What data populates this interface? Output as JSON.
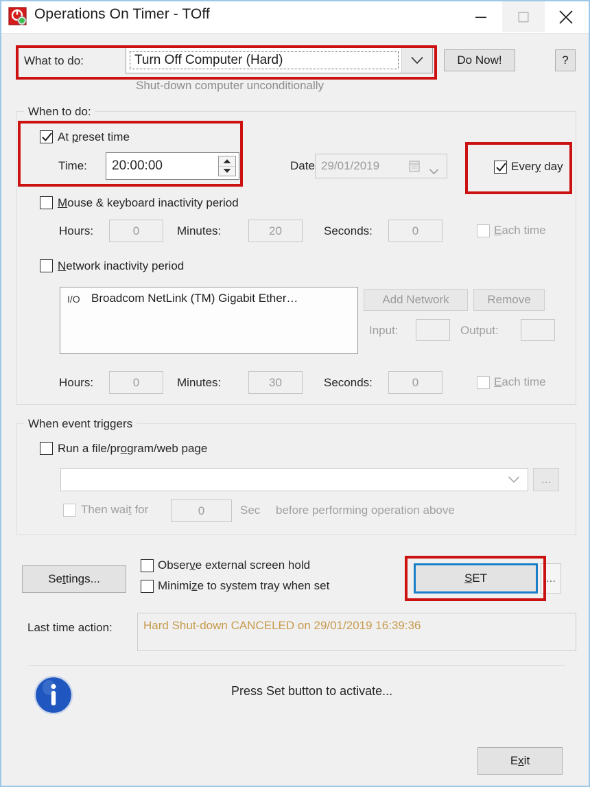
{
  "window": {
    "title": "Operations On Timer - TOff",
    "icon": "toff-app-icon",
    "controls": {
      "minimize": "minimize-icon",
      "maximize": "maximize-icon",
      "close": "close-icon"
    },
    "frame_color": "#9ec8e8",
    "background": "#f0f0f0"
  },
  "what_to_do": {
    "label": "What to do:",
    "label_accel": "W",
    "selected_option": "Turn Off Computer (Hard)",
    "options": [
      "Turn Off Computer (Hard)"
    ],
    "description": "Shut-down computer unconditionally",
    "do_now_label": "Do Now!",
    "do_now_accel": "D",
    "help_label": "?",
    "highlight_color": "#cc1111"
  },
  "when_to_do": {
    "group_title": "When to do:",
    "at_preset_time": {
      "label": "At preset time",
      "accel": "p",
      "checked": true,
      "time_label": "Time:",
      "time_value": "20:00:00",
      "date_label": "Date:",
      "date_value": "29/01/2019",
      "date_enabled": false
    },
    "every_day": {
      "label": "Every day",
      "accel": "y",
      "checked": true
    },
    "mouse_keyboard": {
      "label": "Mouse & keyboard inactivity period",
      "accel": "M",
      "checked": false,
      "hours_label": "Hours:",
      "hours_value": "0",
      "minutes_label": "Minutes:",
      "minutes_value": "20",
      "seconds_label": "Seconds:",
      "seconds_value": "0",
      "each_time_label": "Each time",
      "each_time_accel": "E",
      "each_time_checked": false
    },
    "network": {
      "label": "Network inactivity period",
      "accel": "N",
      "checked": false,
      "adapters": [
        {
          "icon": "io-icon",
          "name": "Broadcom NetLink (TM) Gigabit Ether…"
        }
      ],
      "add_network_label": "Add Network",
      "add_network_accel": "A",
      "remove_label": "Remove",
      "remove_accel": "R",
      "input_label": "Input:",
      "input_value": "",
      "output_label": "Output:",
      "output_value": "",
      "hours_label": "Hours:",
      "hours_value": "0",
      "minutes_label": "Minutes:",
      "minutes_value": "30",
      "seconds_label": "Seconds:",
      "seconds_value": "0",
      "each_time_label": "Each time",
      "each_time_accel": "E",
      "each_time_checked": false
    }
  },
  "when_event_triggers": {
    "group_title": "When event triggers",
    "run_file": {
      "label": "Run a file/program/web page",
      "accel": "o",
      "checked": false,
      "path_value": "",
      "browse_label": "..."
    },
    "then_wait": {
      "label": "Then wait for",
      "accel": "t",
      "checked": false,
      "seconds_value": "0",
      "sec_label": "Sec",
      "suffix_label": "before performing operation above"
    }
  },
  "bottom": {
    "settings_label": "Settings...",
    "settings_accel": "t",
    "observe_screen_hold": {
      "label": "Observe external screen hold",
      "accel": "v",
      "checked": false
    },
    "minimize_tray": {
      "label": "Minimize to system tray when set",
      "accel": "z",
      "checked": false
    },
    "set_label": "SET",
    "set_accel": "S",
    "set_focus_color": "#1a7fc8",
    "set_more_label": "...",
    "last_time_action_label": "Last time action:",
    "last_time_action_value": "Hard Shut-down CANCELED on 29/01/2019 16:39:36",
    "last_time_action_color": "#c79a4b"
  },
  "status": {
    "icon": "info-icon",
    "message": "Press Set button to activate...",
    "exit_label": "Exit",
    "exit_accel": "x"
  }
}
